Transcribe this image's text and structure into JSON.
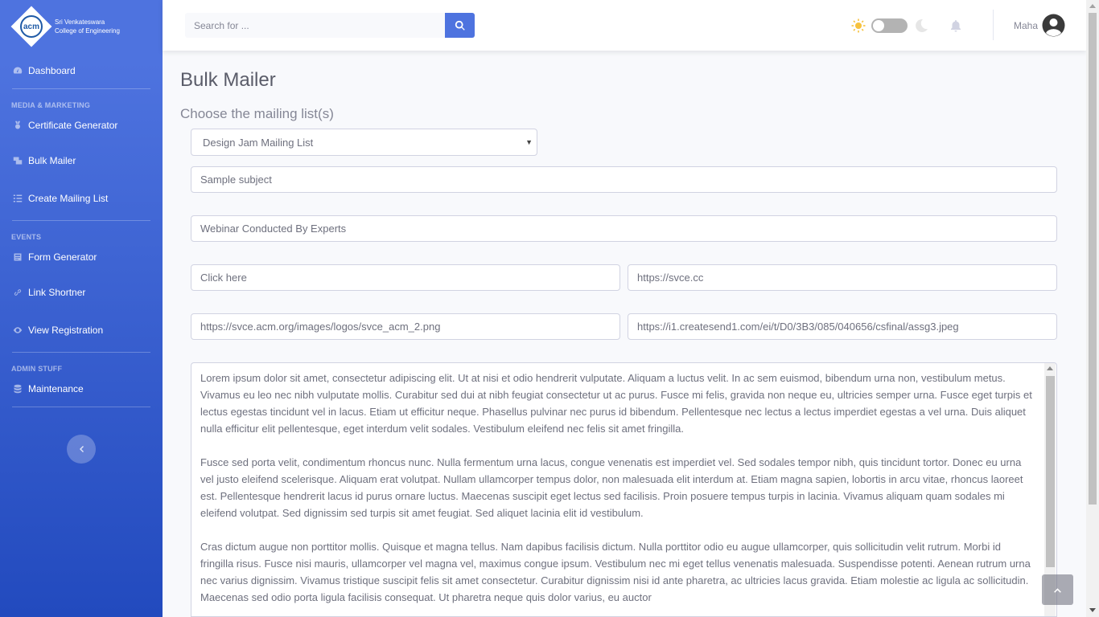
{
  "brand": {
    "logo_text": "acm",
    "line1": "Sri Venkateswara",
    "line2": "College of Engineering"
  },
  "sidebar": {
    "dashboard": "Dashboard",
    "heading_media": "MEDIA & MARKETING",
    "certificate_generator": "Certificate Generator",
    "bulk_mailer": "Bulk Mailer",
    "create_mailing_list": "Create Mailing List",
    "heading_events": "EVENTS",
    "form_generator": "Form Generator",
    "link_shortner": "Link Shortner",
    "view_registration": "View Registration",
    "heading_admin": "ADMIN STUFF",
    "maintenance": "Maintenance"
  },
  "topbar": {
    "search_placeholder": "Search for ...",
    "user_name": "Maha"
  },
  "colors": {
    "primary": "#4e73df",
    "sidebar_gradient_end": "#224abe",
    "sun": "#f6c23e"
  },
  "main": {
    "title": "Bulk Mailer",
    "subtitle": "Choose the mailing list(s)",
    "mailing_list_selected": "Design Jam Mailing List",
    "subject": "Sample subject",
    "heading": "Webinar Conducted By Experts",
    "button_text": "Click here",
    "button_link": "https://svce.cc",
    "logo_url": "https://svce.acm.org/images/logos/svce_acm_2.png",
    "image_url": "https://i1.createsend1.com/ei/t/D0/3B3/085/040656/csfinal/assg3.jpeg",
    "body": "Lorem ipsum dolor sit amet, consectetur adipiscing elit. Ut at nisi et odio hendrerit vulputate. Aliquam a luctus velit. In ac sem euismod, bibendum urna non, vestibulum metus. Vivamus eu leo nec nibh vulputate mollis. Curabitur sed dui at nibh feugiat consectetur ut ac purus. Fusce mi felis, gravida non neque eu, ultricies semper urna. Fusce eget turpis et lectus egestas tincidunt vel in lacus. Etiam ut efficitur neque. Phasellus pulvinar nec purus id bibendum. Pellentesque nec lectus a lectus imperdiet egestas a vel urna. Duis aliquet nulla efficitur elit pellentesque, eget interdum velit sodales. Vestibulum eleifend nec felis sit amet fringilla.\n\nFusce sed porta velit, condimentum rhoncus nunc. Nulla fermentum urna lacus, congue venenatis est imperdiet vel. Sed sodales tempor nibh, quis tincidunt tortor. Donec eu urna vel justo eleifend scelerisque. Aliquam erat volutpat. Nullam ullamcorper tempus dolor, non malesuada elit interdum at. Etiam magna sapien, lobortis in arcu vitae, rhoncus laoreet est. Pellentesque hendrerit lacus id purus ornare luctus. Maecenas suscipit eget lectus sed facilisis. Proin posuere tempus turpis in lacinia. Vivamus aliquam quam sodales mi eleifend volutpat. Sed dignissim sed turpis sit amet feugiat. Sed aliquet lacinia elit id vestibulum.\n\nCras dictum augue non porttitor mollis. Quisque et magna tellus. Nam dapibus facilisis dictum. Nulla porttitor odio eu augue ullamcorper, quis sollicitudin velit rutrum. Morbi id fringilla risus. Fusce nisi mauris, ullamcorper vel magna vel, maximus congue ipsum. Vestibulum nec mi eget tellus venenatis malesuada. Suspendisse potenti. Aenean rutrum urna nec varius dignissim. Vivamus tristique suscipit felis sit amet consectetur. Curabitur dignissim nisi id ante pharetra, ac ultricies lacus gravida. Etiam molestie ac ligula ac sollicitudin. Maecenas sed odio porta ligula facilisis consequat. Ut pharetra neque quis dolor varius, eu auctor"
  }
}
